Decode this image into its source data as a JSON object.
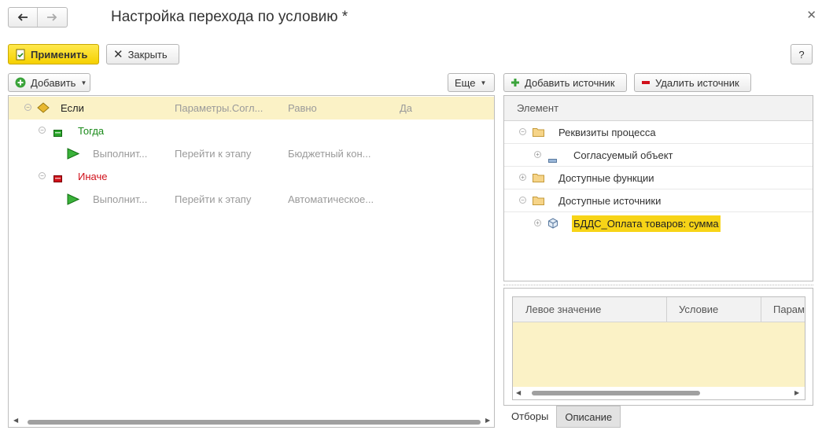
{
  "window": {
    "title": "Настройка перехода по условию *",
    "back_icon": "arrow-left-icon",
    "forward_icon": "arrow-right-icon",
    "close_icon": "close-icon"
  },
  "toolbar": {
    "apply_label": "Применить",
    "close_label": "Закрыть",
    "help_label": "?"
  },
  "left": {
    "add_label": "Добавить",
    "more_label": "Еще",
    "rows": [
      {
        "label": "Если",
        "c1": "Параметры.Согл...",
        "c2": "Равно",
        "c3": "Да"
      },
      {
        "label": "Тогда"
      },
      {
        "label": "Выполнит...",
        "c1": "Перейти к этапу",
        "c2": "Бюджетный кон..."
      },
      {
        "label": "Иначе"
      },
      {
        "label": "Выполнит...",
        "c1": "Перейти к этапу",
        "c2": "Автоматическое..."
      }
    ]
  },
  "right": {
    "add_source_label": "Добавить источник",
    "remove_source_label": "Удалить источник",
    "column_header": "Элемент",
    "tree": [
      {
        "label": "Реквизиты процесса"
      },
      {
        "label": "Согласуемый объект"
      },
      {
        "label": "Доступные функции"
      },
      {
        "label": "Доступные источники"
      },
      {
        "label": "БДДС_Оплата товаров: сумма"
      }
    ],
    "filter_grid": {
      "columns": [
        "Левое значение",
        "Условие",
        "Парам"
      ]
    },
    "tabs": [
      "Отборы",
      "Описание"
    ]
  },
  "colors": {
    "accent_yellow": "#f5d000",
    "selection": "#fbf2c6",
    "then_green": "#1a8a1a",
    "else_red": "#d0101a"
  }
}
